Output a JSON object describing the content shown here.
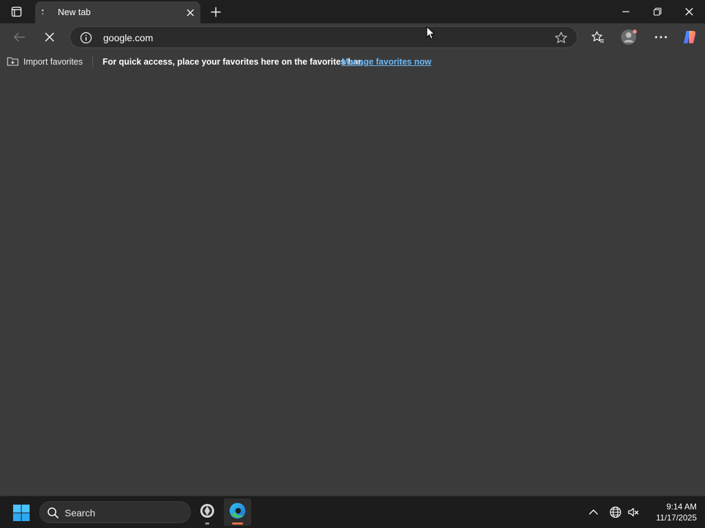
{
  "browser": {
    "tab": {
      "title": "New tab"
    },
    "address_bar": {
      "url": "google.com"
    },
    "favorites_bar": {
      "import_label": "Import favorites",
      "message": "For quick access, place your favorites here on the favorites bar.",
      "link_label": "Manage favorites now"
    }
  },
  "taskbar": {
    "search_label": "Search",
    "time": "9:14 AM",
    "date": "11/17/2025"
  },
  "colors": {
    "content_bg": "#3b3b3b",
    "titlebar_bg": "#1f1f1f",
    "taskbar_bg": "#1c1c1c",
    "link": "#6cb8f6",
    "edge_indicator": "#e8734a"
  },
  "icons": [
    "tab-actions-icon",
    "loading-icon",
    "close-icon",
    "plus-icon",
    "minimize-icon",
    "restore-icon",
    "back-arrow-icon",
    "stop-icon",
    "info-icon",
    "star-icon",
    "favorites-icon",
    "profile-icon",
    "more-icon",
    "copilot-icon",
    "folder-import-icon",
    "windows-start-icon",
    "search-icon",
    "app-icon",
    "edge-icon",
    "chevron-up-icon",
    "globe-icon",
    "volume-muted-icon"
  ]
}
